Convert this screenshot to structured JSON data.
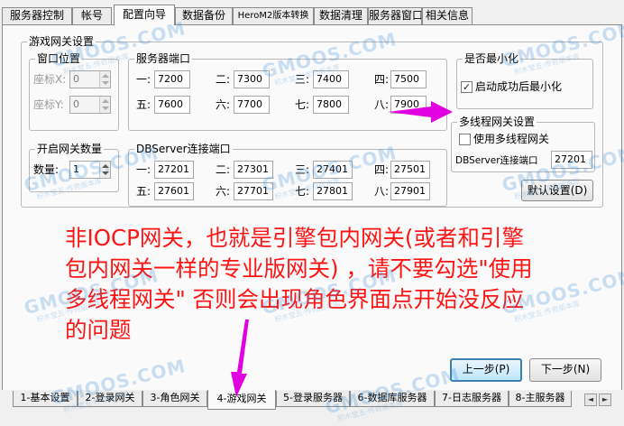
{
  "top_tabs": [
    "服务器控制",
    "帐号",
    "配置向导",
    "数据备份",
    "HeroM2版本转换",
    "数据清理",
    "服务器窗口",
    "相关信息"
  ],
  "gateway_group": {
    "legend": "游戏网关设置"
  },
  "window_position": {
    "legend": "窗口位置",
    "x_label": "座标X:",
    "x_value": "0",
    "y_label": "座标Y:",
    "y_value": "0"
  },
  "gateway_count": {
    "legend": "开启网关数量",
    "count_label": "数量:",
    "count_value": "1"
  },
  "server_ports": {
    "legend": "服务器端口",
    "labels": [
      "一:",
      "二:",
      "三:",
      "四:",
      "五:",
      "六:",
      "七:",
      "八:"
    ],
    "values": [
      "7200",
      "7300",
      "7400",
      "7500",
      "7600",
      "7700",
      "7800",
      "7900"
    ]
  },
  "dbserver_ports": {
    "legend": "DBServer连接端口",
    "labels": [
      "一:",
      "二:",
      "三:",
      "四:",
      "五:",
      "六:",
      "七:",
      "八:"
    ],
    "values": [
      "27201",
      "27301",
      "27401",
      "27501",
      "27601",
      "27701",
      "27801",
      "27901"
    ]
  },
  "minimize": {
    "legend": "是否最小化",
    "checkbox_label": "启动成功后最小化",
    "checked": true
  },
  "multithread": {
    "legend": "多线程网关设置",
    "checkbox_label": "使用多线程网关",
    "checked": false,
    "dbport_label": "DBServer连接端口",
    "dbport_value": "27201"
  },
  "default_button": "默认设置(D)",
  "notice_lines": [
    "非IOCP网关，也就是引擎包内网关(或者和引擎",
    "包内网关一样的专业版网关) ，请不要勾选\"使用",
    "多线程网关\" 否则会出现角色界面点开始没反应",
    "的问题"
  ],
  "prev_button": "上一步(P)",
  "next_button": "下一步(N)",
  "watermark": {
    "brand": "GMOOS.COM",
    "slogan": "积木堂五·传奇版本库"
  },
  "bottom_tabs": [
    "1-基本设置",
    "2-登录网关",
    "3-角色网关",
    "4-游戏网关",
    "5-登录服务器",
    "6-数据库服务器",
    "7-日志服务器",
    "8-主服务器"
  ],
  "scroll_icons": {
    "left": "◄",
    "right": "►"
  },
  "colors": {
    "notice": "#ff1414",
    "arrow": "#e000e0",
    "watermark": "#3e8fd6"
  }
}
